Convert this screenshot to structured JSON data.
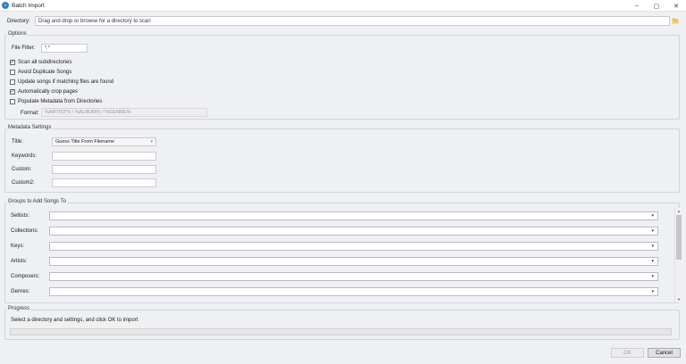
{
  "window": {
    "title": "Batch Import",
    "controls": {
      "minimize": "–",
      "maximize": "▢",
      "close": "✕"
    }
  },
  "directory": {
    "label": "Directory:",
    "value": "Drag and drop or browse for a directory to scan",
    "browse_icon": "folder-icon"
  },
  "options": {
    "title": "Options",
    "file_filter_label": "File Filter:",
    "file_filter_value": "*.*",
    "checkboxes": [
      {
        "label": "Scan all subdirectories",
        "checked": true
      },
      {
        "label": "Avoid Duplicate Songs",
        "checked": false
      },
      {
        "label": "Update songs if matching files are found",
        "checked": false
      },
      {
        "label": "Automatically crop pages",
        "checked": true
      },
      {
        "label": "Populate Metadata from Directories",
        "checked": false
      }
    ],
    "format_label": "Format:",
    "format_value": "%ARTIST% / %ALBUM% / %GENRE%"
  },
  "metadata": {
    "title": "Metadata Settings",
    "title_label": "Title:",
    "title_value": "Guess Title From Filename",
    "keywords_label": "Keywords:",
    "custom_label": "Custom:",
    "custom2_label": "Custom2:"
  },
  "groups": {
    "title": "Groups to Add Songs To",
    "rows": [
      {
        "label": "Setlists:"
      },
      {
        "label": "Collections:"
      },
      {
        "label": "Keys:"
      },
      {
        "label": "Artists:"
      },
      {
        "label": "Composers:"
      },
      {
        "label": "Genres:"
      }
    ]
  },
  "progress": {
    "title": "Progress",
    "status": "Select a directory and settings, and click OK to import",
    "value": 0
  },
  "buttons": {
    "ok": "OK",
    "cancel": "Cancel"
  },
  "colors": {
    "accent": "#2f80d1",
    "folder": "#e8b43a",
    "background": "#eef0f3"
  }
}
